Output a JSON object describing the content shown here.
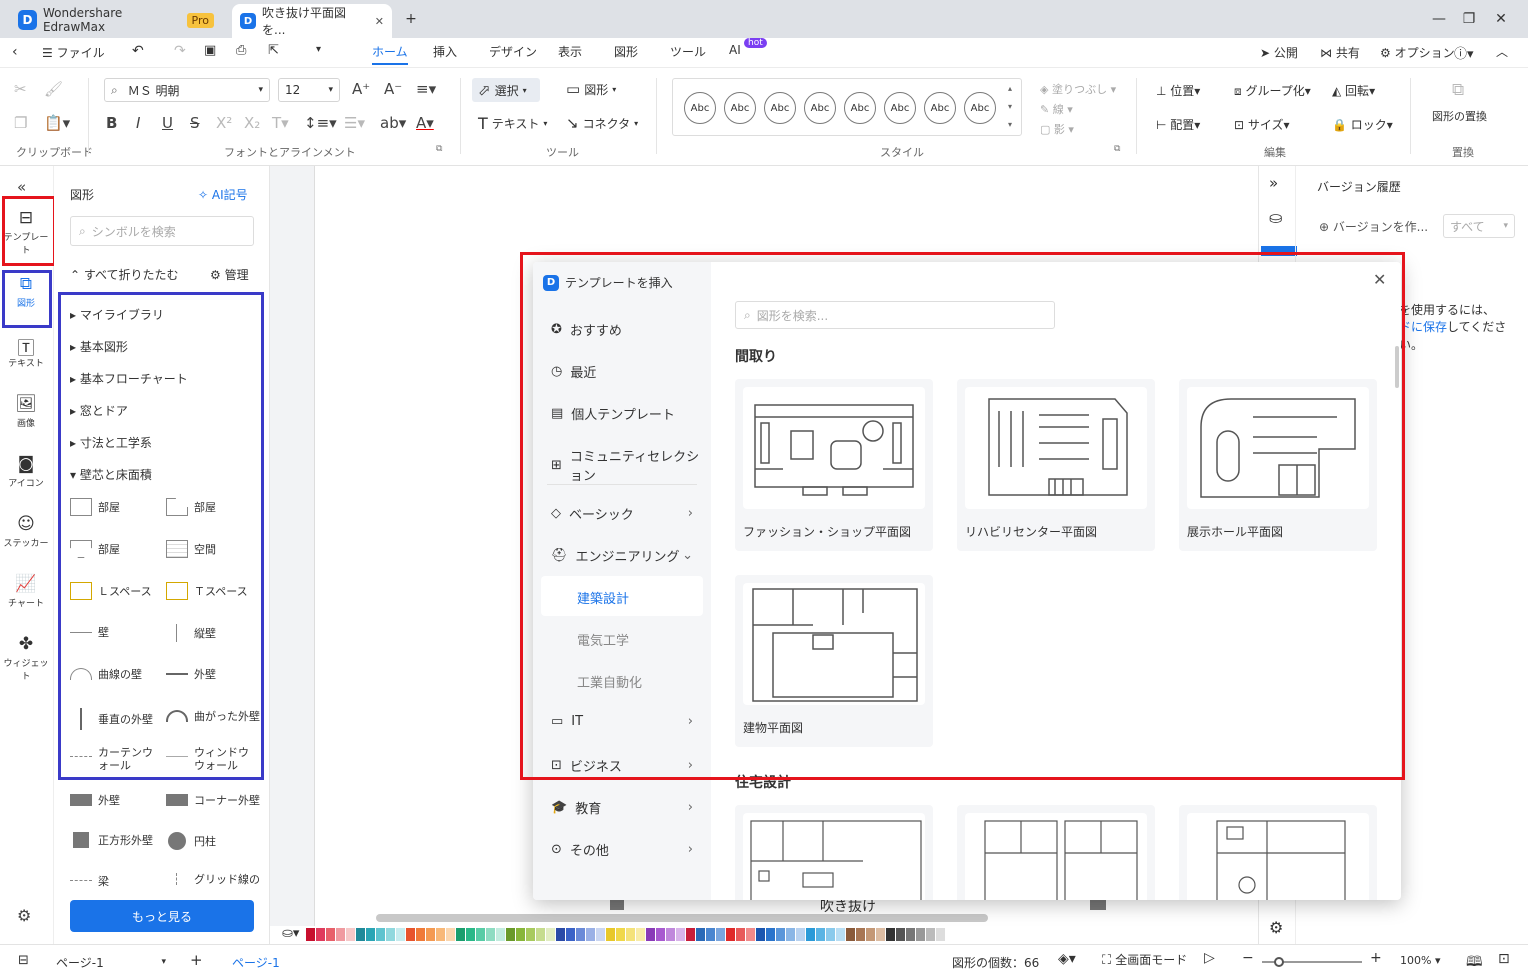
{
  "window": {
    "app_title": "Wondershare EdrawMax",
    "pro_badge": "Pro",
    "doc_tab": "吹き抜け平面図を...",
    "min": "—",
    "max": "❐",
    "close": "✕",
    "new_tab": "+",
    "tab_close": "✕"
  },
  "menu": {
    "file": "ファイル",
    "tabs": [
      "ホーム",
      "挿入",
      "デザイン",
      "表示",
      "図形",
      "ツール",
      "AI"
    ],
    "hot": "hot",
    "right": [
      "公開",
      "共有",
      "オプション"
    ]
  },
  "ribbon": {
    "font_name": "ＭＳ 明朝",
    "font_size": "12",
    "select": "選択",
    "shape": "図形",
    "text": "テキスト",
    "connector": "コネクタ",
    "abc": "Abc",
    "fill": "塗りつぶし",
    "line": "線",
    "shadow": "影",
    "position": "位置",
    "group": "グループ化",
    "rotate": "回転",
    "align": "配置",
    "size": "サイズ",
    "lock": "ロック",
    "replace": "図形の置換",
    "groups": [
      "クリップボード",
      "フォントとアラインメント",
      "ツール",
      "スタイル",
      "編集",
      "置換"
    ]
  },
  "rail": [
    "テンプレート",
    "図形",
    "テキスト",
    "画像",
    "アイコン",
    "ステッカー",
    "チャート",
    "ウィジェット"
  ],
  "panel": {
    "title": "図形",
    "ai": "AI記号",
    "search_placeholder": "シンボルを検索",
    "collapse_all": "すべて折りたたむ",
    "manage": "管理",
    "categories": [
      "マイライブラリ",
      "基本図形",
      "基本フローチャート",
      "窓とドア",
      "寸法と工学系",
      "壁芯と床面積"
    ],
    "shapes": [
      [
        "部屋",
        "部屋"
      ],
      [
        "部屋",
        "空間"
      ],
      [
        "Ｌスペース",
        "Ｔスペース"
      ],
      [
        "壁",
        "縦壁"
      ],
      [
        "曲線の壁",
        "外壁"
      ],
      [
        "垂直の外壁",
        "曲がった外壁"
      ],
      [
        "カーテンウォール",
        "ウィンドウウォール"
      ],
      [
        "外壁",
        "コーナー外壁"
      ],
      [
        "正方形外壁",
        "円柱"
      ],
      [
        "梁",
        "グリッド線の"
      ]
    ],
    "more": "もっと見る"
  },
  "right": {
    "title": "バージョン履歴",
    "create": "バージョンを作...",
    "filter": "すべて",
    "text1": "を使用するには、",
    "text2": "ドに保存",
    "text3": "してくださ",
    "text4": "い。"
  },
  "modal": {
    "title": "テンプレートを挿入",
    "search_placeholder": "図形を検索...",
    "nav": [
      "おすすめ",
      "最近",
      "個人テンプレート",
      "コミュニティセレクション",
      "ベーシック",
      "エンジニアリング",
      "IT",
      "ビジネス",
      "教育",
      "その他"
    ],
    "sub": [
      "建築設計",
      "電気工学",
      "工業自動化"
    ],
    "section1": "間取り",
    "section2": "住宅設計",
    "cards": [
      "ファッション・ショップ平面図",
      "リハビリセンター平面図",
      "展示ホール平面図",
      "建物平面図"
    ]
  },
  "canvas": {
    "bottom_label": "吹き抜け"
  },
  "status": {
    "page_select": "ページ-1",
    "page_tab": "ページ-1",
    "count": "図形の個数：66",
    "fullscreen": "全画面モード",
    "zoom": "100%"
  },
  "colors": {
    "accent": "#1a73e8",
    "red_highlight": "#e5141c",
    "blue_highlight": "#3a3ac8"
  }
}
